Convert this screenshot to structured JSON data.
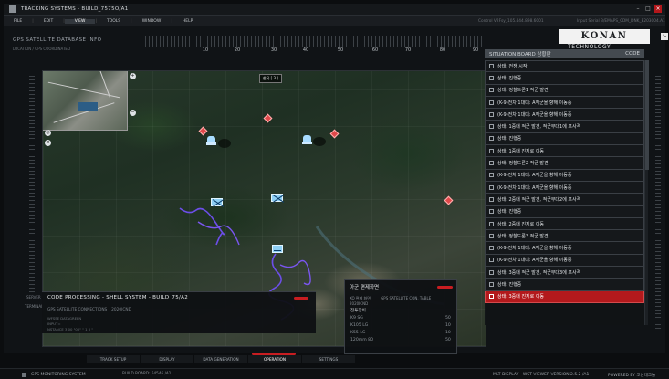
{
  "window": {
    "title": "TRACKING SYSTEMS - BUILD_7575O/A1"
  },
  "menu": [
    "FILE",
    "EDIT",
    "VIEW",
    "TOOLS",
    "WINDOW",
    "HELP"
  ],
  "menu_active": "VIEW",
  "header": {
    "info_center": "Control V2Fsy_105.444.898.6001",
    "info_right": "Input Serial B/EMAPS_0DM_DNK_E203004.A1"
  },
  "top": {
    "database": "GPS SATELLITE DATABASE INFO",
    "location": "LOCATION / GPS COORDINATED"
  },
  "ruler_labels": [
    "10",
    "20",
    "30",
    "40",
    "50",
    "60",
    "70",
    "80",
    "90"
  ],
  "logo": {
    "brand": "KONAN",
    "sub": "TECHNOLOGY"
  },
  "situation": {
    "title": "SITUATION BOARD 상황판",
    "code_label": "CODE",
    "rows": [
      "상태: 전쟁 시작",
      "상태: 진행중",
      "상태: 정찰드론1 적군 발견",
      "(K-9)전차 1대대: A적군을 향해 이동중",
      "(K-9)전차 1대대: A적군을 향해 이동중",
      "상태: 1중대 적군 발견, 적군부대1에 포사격",
      "상태: 진행중",
      "상태: 1중대 진지로 이동",
      "상태: 정찰드론2 적군 발견",
      "(K-9)전차 1대대: A적군을 향해 이동중",
      "(K-9)전차 1대대: A적군을 향해 이동중",
      "상태: 2중대 적군 발견, 적군부대2에 포사격",
      "상태: 진행중",
      "상태: 2중대 진지로 이동",
      "상태: 정찰드론3 적군 발견",
      "(K-9)전차 1대대: A적군을 향해 이동중",
      "(K-9)전차 1대대: A적군을 향해 이동중",
      "상태: 3중대 적군 발견, 적군부대3에 포사격",
      "상태: 진행중",
      "상태: 3중대 진지로 이동"
    ],
    "active_index": 19
  },
  "code_processing": {
    "title": "CODE PROCESSING - SHELL SYSTEM - BUILD_75/A2",
    "sub": "GPS SATELLITE CONNECTIONS _ 2020ICND",
    "lines": [
      "WFSSE DATAGREEN",
      "INPUT=",
      "NSTANCE 3 00 \"00\" \" 1 0 \""
    ]
  },
  "fire_panel": {
    "title": "아군 편제화면",
    "tabs": [
      "XO 편제 화면",
      "GPS SATELLITE CON. TABLE_ 2020ICND"
    ],
    "section": "전투장비",
    "weapons": [
      {
        "name": "K9 SG",
        "value": "50"
      },
      {
        "name": "K105 LG",
        "value": "10"
      },
      {
        "name": "K55 LG",
        "value": "10"
      },
      {
        "name": "120mm 80",
        "value": "50"
      }
    ]
  },
  "side_labels": {
    "server": "SERVER",
    "terminal": "TERMINAL"
  },
  "map_callout": "한국 [ 3 ]",
  "bottom_tabs": [
    "TRACK SETUP",
    "DISPLAY",
    "DATA GENERATION",
    "OPERATION",
    "SETTINGS"
  ],
  "bottom_active": "OPERATION",
  "statusbar": {
    "left": "GPS MONITORING SYSTEM",
    "board": "BUILD BOARD: 54546 /A1",
    "center": "MLT DISPLAY - WST VIEWER VERSION 2.5.2 /A1",
    "right": "POWERED BY 코난테크놀"
  },
  "accent_red": "#c81d21"
}
